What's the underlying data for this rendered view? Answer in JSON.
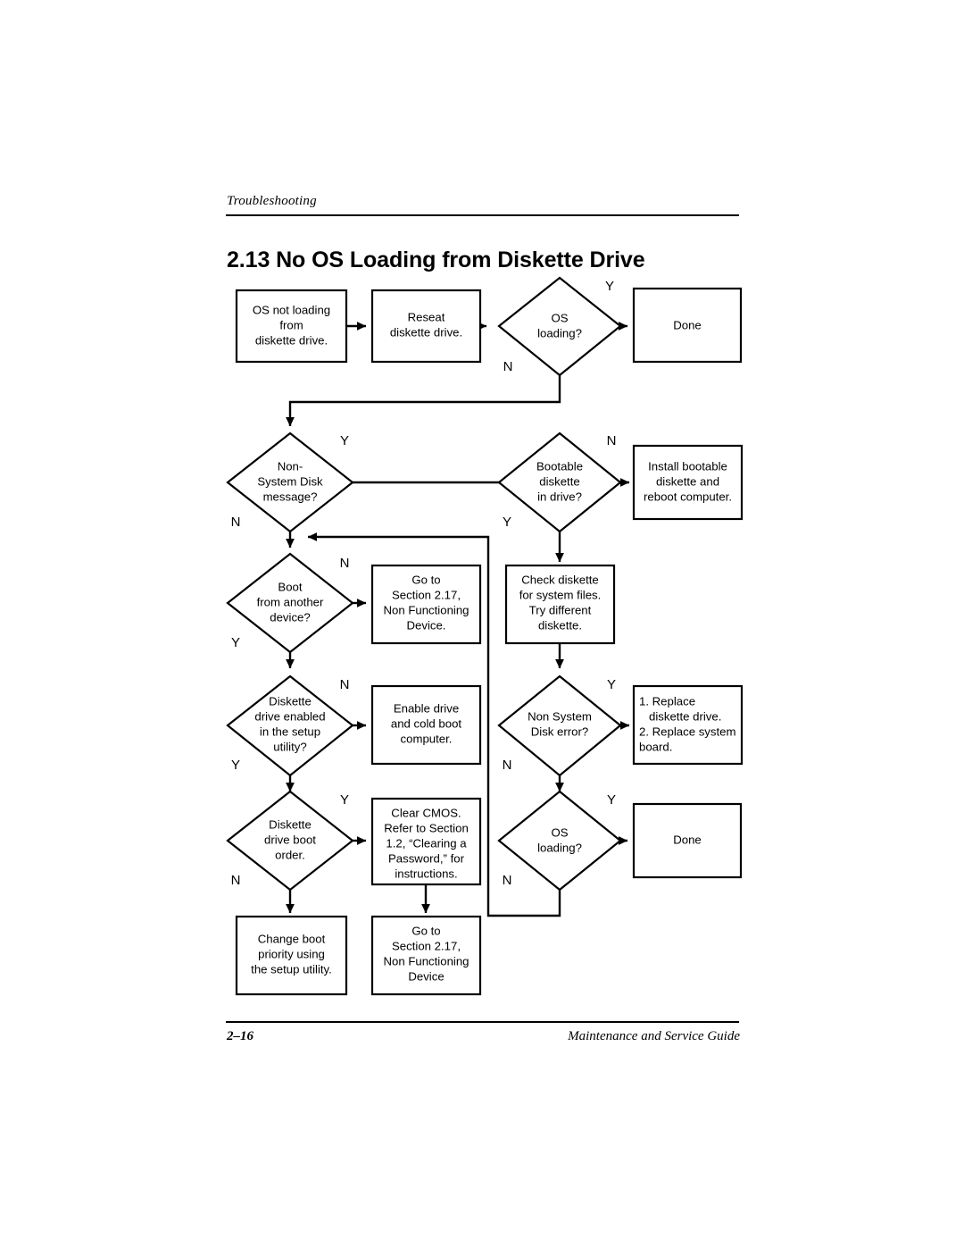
{
  "page": {
    "running_head": "Troubleshooting",
    "section_number": "2.13",
    "section_title": "2.13 No OS Loading from Diskette Drive",
    "folio": "2–16",
    "guide_title": "Maintenance and Service Guide"
  },
  "flowchart": {
    "title": "No OS Loading from Diskette Drive",
    "nodes": {
      "start": {
        "type": "process",
        "lines": [
          "OS not loading",
          "from",
          "diskette drive."
        ]
      },
      "reseat": {
        "type": "process",
        "lines": [
          "Reseat",
          "diskette drive."
        ]
      },
      "os_loading_1": {
        "type": "decision",
        "lines": [
          "OS",
          "loading?"
        ]
      },
      "done_1": {
        "type": "terminator",
        "lines": [
          "Done"
        ]
      },
      "non_system_disk": {
        "type": "decision",
        "lines": [
          "Non-",
          "System Disk",
          "message?"
        ]
      },
      "bootable_diskette": {
        "type": "decision",
        "lines": [
          "Bootable",
          "diskette",
          "in drive?"
        ]
      },
      "install_bootable": {
        "type": "process",
        "lines": [
          "Install bootable",
          "diskette and",
          "reboot computer."
        ]
      },
      "boot_another": {
        "type": "decision",
        "lines": [
          "Boot",
          "from another",
          "device?"
        ]
      },
      "goto_217_a": {
        "type": "process",
        "lines": [
          "Go to",
          "Section 2.17,",
          "Non Functioning",
          "Device."
        ]
      },
      "check_diskette": {
        "type": "process",
        "lines": [
          "Check diskette",
          "for system files.",
          "Try different",
          "diskette."
        ]
      },
      "drive_enabled": {
        "type": "decision",
        "lines": [
          "Diskette",
          "drive enabled",
          "in the setup",
          "utility?"
        ]
      },
      "enable_drive": {
        "type": "process",
        "lines": [
          "Enable drive",
          "and cold boot",
          "computer."
        ]
      },
      "non_system_error": {
        "type": "decision",
        "lines": [
          "Non System",
          "Disk error?"
        ]
      },
      "replace_list": {
        "type": "process",
        "lines": [
          "1. Replace",
          "diskette drive.",
          "2. Replace system",
          "board."
        ]
      },
      "boot_order": {
        "type": "decision",
        "lines": [
          "Diskette",
          "drive boot",
          "order."
        ]
      },
      "clear_cmos": {
        "type": "process",
        "lines": [
          "Clear CMOS.",
          "Refer to Section",
          "1.2, “Clearing a",
          "Password,” for",
          "instructions."
        ]
      },
      "os_loading_2": {
        "type": "decision",
        "lines": [
          "OS",
          "loading?"
        ]
      },
      "done_2": {
        "type": "terminator",
        "lines": [
          "Done"
        ]
      },
      "change_boot_priority": {
        "type": "process",
        "lines": [
          "Change boot",
          "priority using",
          "the setup utility."
        ]
      },
      "goto_217_b": {
        "type": "process",
        "lines": [
          "Go to",
          "Section 2.17,",
          "Non Functioning",
          "Device"
        ]
      }
    },
    "branch_labels": {
      "os_loading_1_yes": "Y",
      "os_loading_1_no": "N",
      "non_system_disk_yes": "Y",
      "non_system_disk_no": "N",
      "bootable_diskette_no": "N",
      "bootable_diskette_yes": "Y",
      "boot_another_no": "N",
      "boot_another_yes": "Y",
      "drive_enabled_no": "N",
      "drive_enabled_yes": "Y",
      "non_system_error_yes": "Y",
      "non_system_error_no": "N",
      "boot_order_yes": "Y",
      "boot_order_no": "N",
      "os_loading_2_yes": "Y",
      "os_loading_2_no": "N"
    },
    "colors": {
      "stroke": "#000000",
      "fill": "#ffffff",
      "text": "#000000"
    }
  }
}
